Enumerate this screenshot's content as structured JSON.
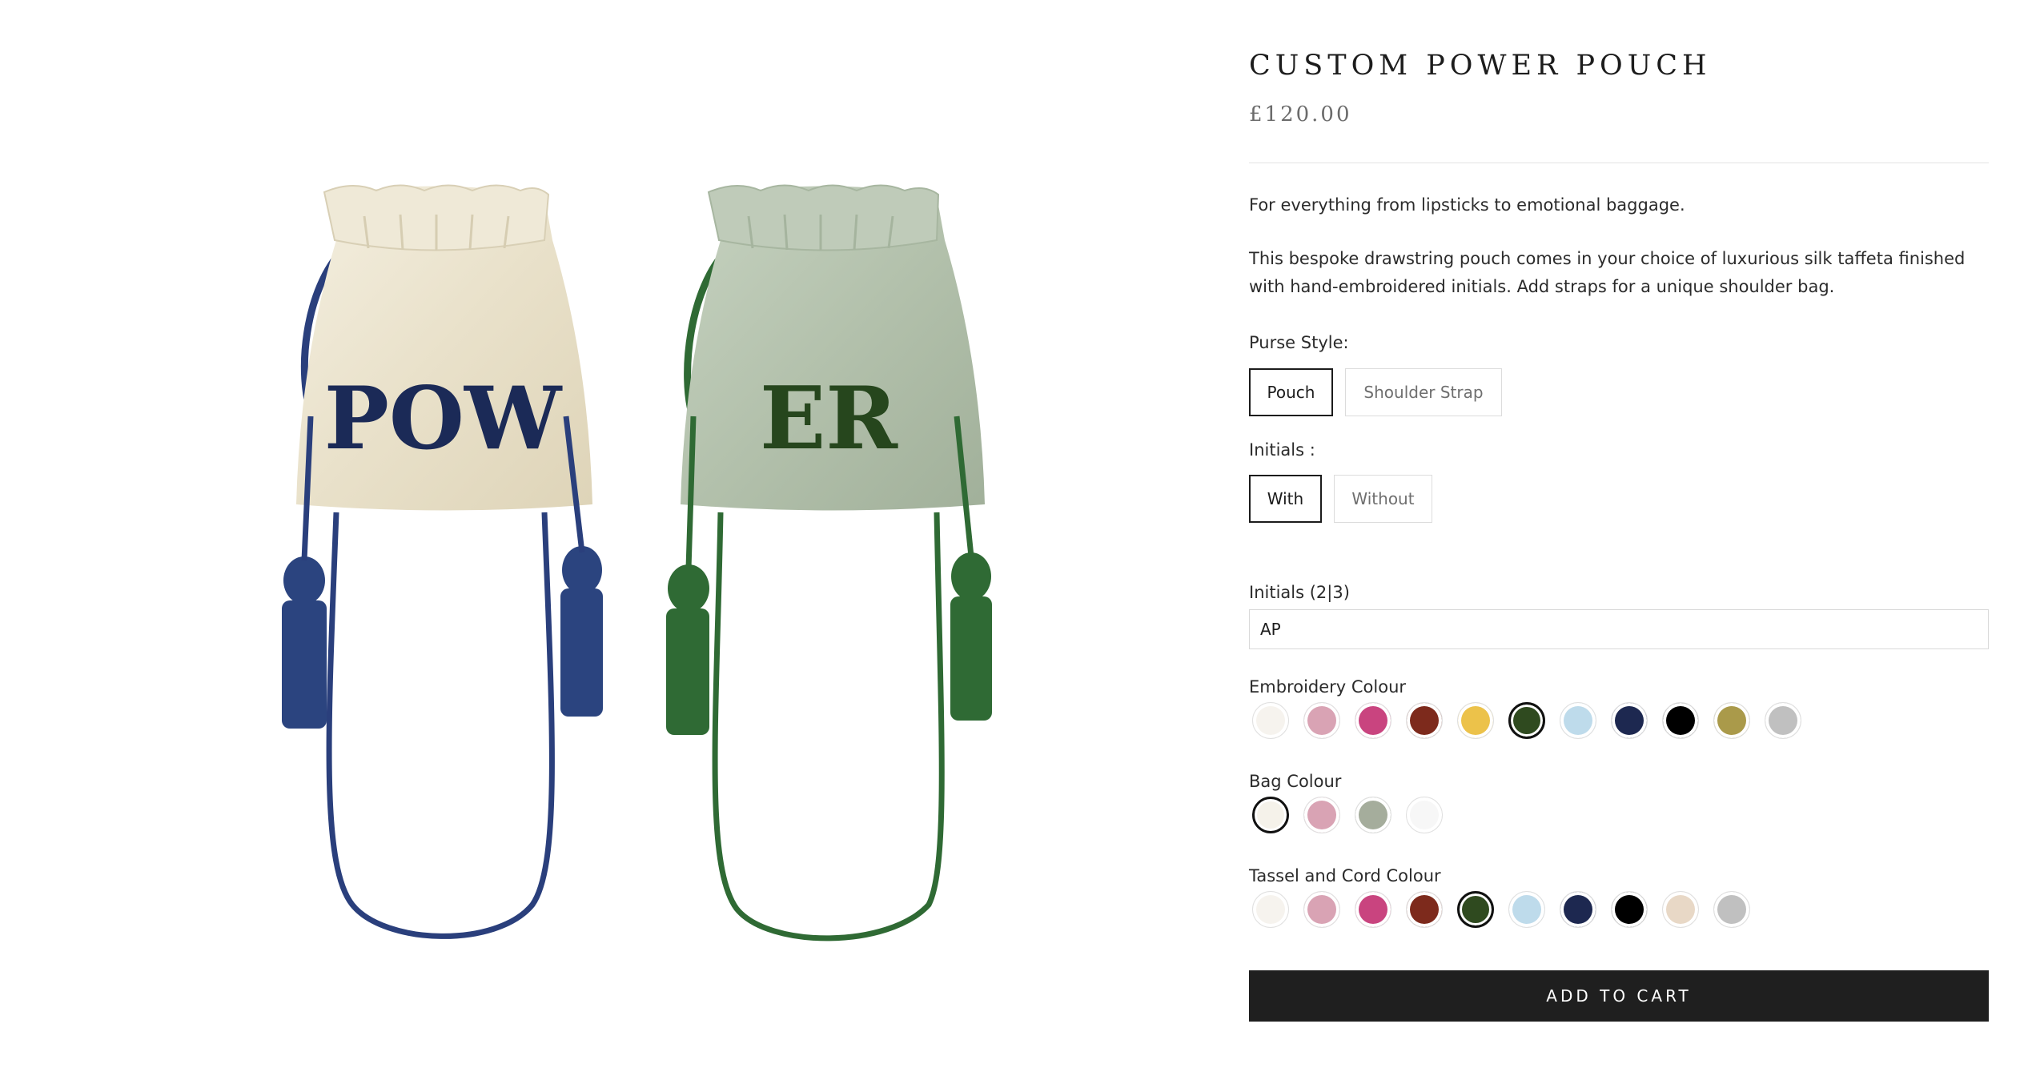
{
  "product": {
    "title": "CUSTOM POWER POUCH",
    "price": "£120.00",
    "description_short": "For everything from lipsticks to emotional baggage.",
    "description_long": "This bespoke drawstring pouch comes in your choice of luxurious silk taffeta finished with hand-embroidered initials. Add straps for a unique shoulder bag."
  },
  "image": {
    "left_bag_text": "POW",
    "right_bag_text": "ER"
  },
  "purse_style": {
    "label": "Purse Style:",
    "options": [
      "Pouch",
      "Shoulder Strap"
    ],
    "selected": "Pouch"
  },
  "initials_toggle": {
    "label": "Initials :",
    "options": [
      "With",
      "Without"
    ],
    "selected": "With"
  },
  "initials_field": {
    "label": "Initials (2|3)",
    "value": "AP"
  },
  "embroidery_colour": {
    "label": "Embroidery Colour",
    "colors": [
      "#f6f3ee",
      "#d9a3b4",
      "#c9447f",
      "#7d2a1c",
      "#ecc24a",
      "#2f4a1f",
      "#bedbeb",
      "#1d2850",
      "#000000",
      "#aa9a4a",
      "#c0c0c0"
    ],
    "selected_index": 5
  },
  "bag_colour": {
    "label": "Bag Colour",
    "colors": [
      "#f5f2ea",
      "#d9a3b4",
      "#a5ad9c",
      "#f7f7f7"
    ],
    "selected_index": 0
  },
  "tassel_colour": {
    "label": "Tassel and Cord Colour",
    "colors": [
      "#f6f3ee",
      "#d9a3b4",
      "#c9447f",
      "#7d2a1c",
      "#2f4a1f",
      "#bedbeb",
      "#1d2850",
      "#000000",
      "#e8d8c6",
      "#c0c0c0"
    ],
    "selected_index": 4
  },
  "cart": {
    "button_label": "ADD TO CART"
  }
}
